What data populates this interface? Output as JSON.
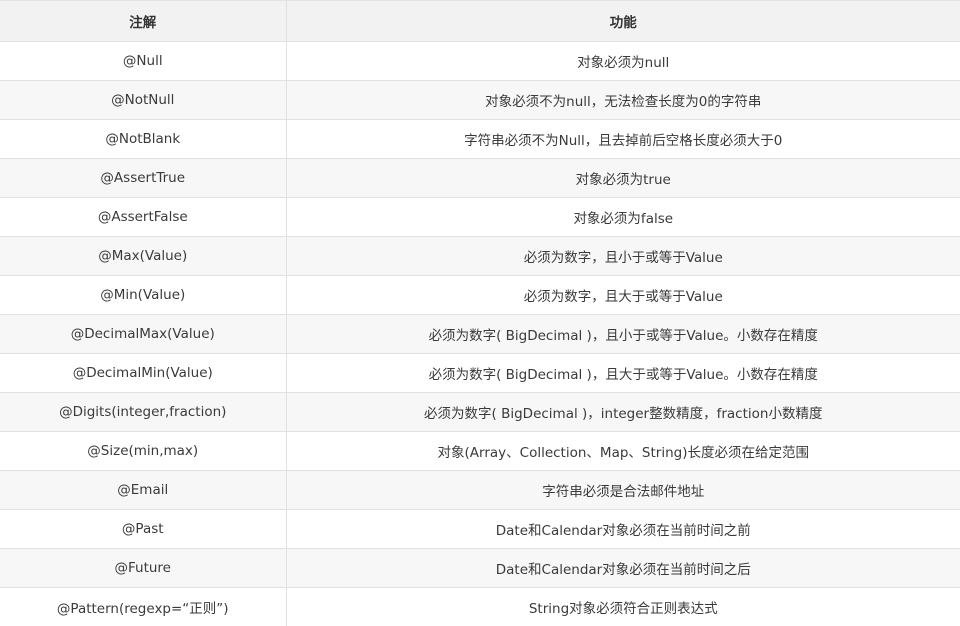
{
  "table": {
    "headers": [
      "注解",
      "功能"
    ],
    "rows": [
      [
        "@Null",
        "对象必须为null"
      ],
      [
        "@NotNull",
        "对象必须不为null，无法检查长度为0的字符串"
      ],
      [
        "@NotBlank",
        "字符串必须不为Null，且去掉前后空格长度必须大于0"
      ],
      [
        "@AssertTrue",
        "对象必须为true"
      ],
      [
        "@AssertFalse",
        "对象必须为false"
      ],
      [
        "@Max(Value)",
        "必须为数字，且小于或等于Value"
      ],
      [
        "@Min(Value)",
        "必须为数字，且大于或等于Value"
      ],
      [
        "@DecimalMax(Value)",
        "必须为数字( BigDecimal )，且小于或等于Value。小数存在精度"
      ],
      [
        "@DecimalMin(Value)",
        "必须为数字( BigDecimal )，且大于或等于Value。小数存在精度"
      ],
      [
        "@Digits(integer,fraction)",
        "必须为数字( BigDecimal )，integer整数精度，fraction小数精度"
      ],
      [
        "@Size(min,max)",
        "对象(Array、Collection、Map、String)长度必须在给定范围"
      ],
      [
        "@Email",
        "字符串必须是合法邮件地址"
      ],
      [
        "@Past",
        "Date和Calendar对象必须在当前时间之前"
      ],
      [
        "@Future",
        "Date和Calendar对象必须在当前时间之后"
      ],
      [
        "@Pattern(regexp=“正则”)",
        "String对象必须符合正则表达式"
      ]
    ]
  }
}
